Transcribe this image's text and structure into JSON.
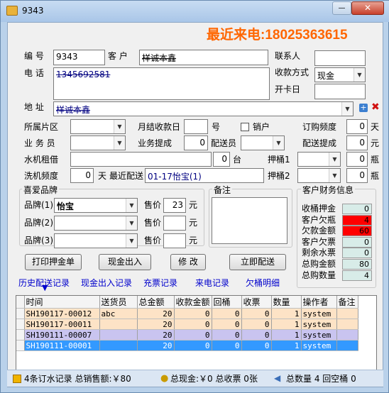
{
  "window": {
    "title": "9343",
    "minimize": "—",
    "close": "✕"
  },
  "banner": "最近来电:18025363615",
  "customer": {
    "code_label": "编 号",
    "code": "9343",
    "name_label": "客 户",
    "name": "样诚本鑫",
    "contact_label": "联系人",
    "contact": "",
    "phone_label": "电 话",
    "phone": "1345692581",
    "pay_label": "收款方式",
    "pay": "现金",
    "card_label": "开卡日",
    "card": "",
    "addr_label": "地 址",
    "addr": "样诚本鑫"
  },
  "fields": {
    "area_label": "所属片区",
    "area": "",
    "monthly_label": "月结收款日",
    "monthly": "",
    "monthly_unit": "号",
    "cancel_label": "销户",
    "freq_label": "订购频度",
    "freq": "0",
    "freq_unit": "天",
    "sales_label": "业 务 员",
    "sales": "",
    "bizcomm_label": "业务提成",
    "bizcomm": "0",
    "deliver_label": "配送员",
    "deliver": "",
    "delcomm_label": "配送提成",
    "delcomm": "0",
    "delcomm_unit": "元",
    "rent_label": "水机租借",
    "rent": "",
    "rent_num": "0",
    "rent_unit": "台",
    "bucket1_label": "押桶1",
    "bucket1": "",
    "bucket1_num": "0",
    "bucket_unit": "瓶",
    "wash_label": "洗机频度",
    "wash": "0",
    "wash_unit": "天",
    "lastdel_label": "最近配送",
    "lastdel": "01-17怡宝(1)",
    "bucket2_label": "押桶2",
    "bucket2": "",
    "bucket2_num": "0"
  },
  "brand": {
    "title": "喜爱品牌",
    "rows": [
      {
        "label": "品牌(1)",
        "value": "怡宝",
        "price_label": "售价",
        "price": "23",
        "unit": "元"
      },
      {
        "label": "品牌(2)",
        "value": "",
        "price_label": "售价",
        "price": "",
        "unit": "元"
      },
      {
        "label": "品牌(3)",
        "value": "",
        "price_label": "售价",
        "price": "",
        "unit": "元"
      }
    ]
  },
  "remark": {
    "title": "备注",
    "text": ""
  },
  "finance": {
    "title": "客户财务信息",
    "rows": [
      {
        "label": "收桶押金",
        "value": "0"
      },
      {
        "label": "客户欠瓶",
        "value": "4"
      },
      {
        "label": "欠款金额",
        "value": "60"
      },
      {
        "label": "客户欠票",
        "value": "0"
      },
      {
        "label": "剩余水票",
        "value": "0"
      },
      {
        "label": "总购金额",
        "value": "80"
      },
      {
        "label": "总购数量",
        "value": "4"
      }
    ]
  },
  "buttons": {
    "print": "打印押金单",
    "cash": "现金出入",
    "edit": "修 改",
    "dispatch": "立即配送"
  },
  "tabs": [
    "历史配送记录",
    "现金出入记录",
    "充票记录",
    "来电记录",
    "欠桶明细"
  ],
  "table": {
    "headers": [
      "时间",
      "送货员",
      "总金额",
      "收款金额",
      "回桶",
      "收票",
      "数量",
      "操作者",
      "备注"
    ],
    "rows": [
      [
        "SH190117-00012",
        "abc",
        "20",
        "0",
        "0",
        "0",
        "1",
        "system",
        ""
      ],
      [
        "SH190117-00011",
        "",
        "20",
        "0",
        "0",
        "0",
        "1",
        "system",
        ""
      ],
      [
        "SH190111-00007",
        "",
        "20",
        "0",
        "0",
        "0",
        "1",
        "system",
        ""
      ],
      [
        "SH190111-00001",
        "",
        "20",
        "0",
        "0",
        "0",
        "1",
        "system",
        ""
      ]
    ]
  },
  "status": {
    "orders": "4条订水记录 总销售额:￥80",
    "cash": "总现金:￥0 总收票 0张",
    "qty": "总数量 4 回空桶 0"
  },
  "colors": {
    "banner": "#ff6600",
    "neg": "#ff0000",
    "row1": "#fde3c6",
    "row2": "#fde3c6",
    "row3": "#c9c4f0",
    "row4": "#3399ff"
  }
}
